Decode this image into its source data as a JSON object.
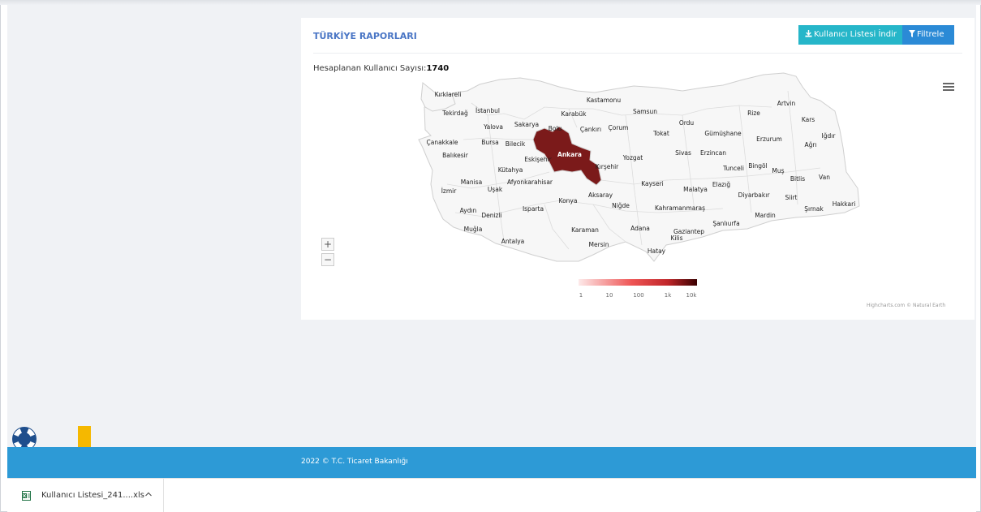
{
  "panel": {
    "title": "TÜRKİYE RAPORLARI",
    "download_button": "Kullanıcı Listesi İndir",
    "filter_button": "Filtrele",
    "count_label": "Hesaplanan Kullanıcı Sayısı:",
    "count_value": "1740"
  },
  "map": {
    "highlighted_province": "Ankara",
    "highlight_color": "#7b1a1a",
    "province_labels": [
      "Kırklareli",
      "Kastamonu",
      "Artvin",
      "Tekirdağ",
      "İstanbul",
      "Karabük",
      "Samsun",
      "Rize",
      "Ordu",
      "Kars",
      "Yalova",
      "Sakarya",
      "Bolu",
      "Çankırı",
      "Çorum",
      "Tokat",
      "Gümüşhane",
      "Iğdır",
      "Çanakkale",
      "Bursa",
      "Bilecik",
      "Ankara",
      "Erzurum",
      "Ağrı",
      "Balıkesir",
      "Eskişehir",
      "Yozgat",
      "Sivas",
      "Erzincan",
      "Kütahya",
      "Kırşehir",
      "Tunceli",
      "Bingöl",
      "Muş",
      "Bitlis",
      "Van",
      "Manisa",
      "Afyonkarahisar",
      "Kayseri",
      "Elazığ",
      "İzmir",
      "Uşak",
      "Malatya",
      "Aksaray",
      "Diyarbakır",
      "Siirt",
      "Konya",
      "Niğde",
      "Hakkari",
      "Aydın",
      "Isparta",
      "Kahramanmaraş",
      "Şırnak",
      "Denizli",
      "Mardin",
      "Şanlıurfa",
      "Muğla",
      "Karaman",
      "Adana",
      "Gaziantep",
      "Kilis",
      "Antalya",
      "Mersin",
      "Hatay"
    ],
    "legend_ticks": [
      "1",
      "10",
      "100",
      "1k",
      "10k"
    ],
    "zoom_in": "+",
    "zoom_out": "−",
    "credits": "Highcharts.com © Natural Earth",
    "menu_icon": "hamburger-menu-icon"
  },
  "footer": {
    "text": "2022 © T.C. Ticaret Bakanlığı",
    "color": "#2d9ad6"
  },
  "download_bar": {
    "filename": "Kullanıcı Listesi_241....xls",
    "caret": "chevron-up-icon"
  },
  "icons": {
    "support": "lifebuoy-icon",
    "arrow": "arrow-down-icon",
    "file": "excel-file-icon",
    "download": "download-icon",
    "filter": "filter-icon"
  },
  "colors": {
    "accent_arrow": "#f5b800",
    "button_download": "#26b6c9",
    "button_filter": "#2b8ad6"
  }
}
